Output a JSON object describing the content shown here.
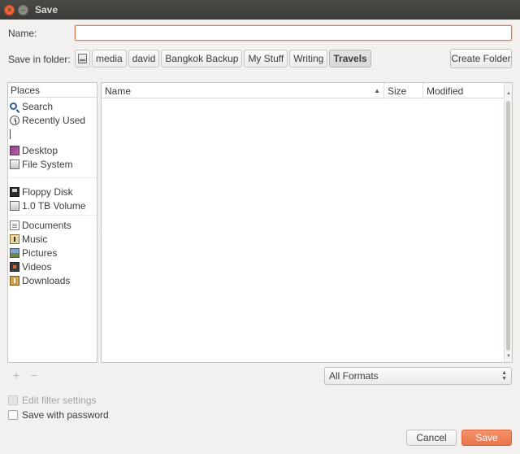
{
  "window": {
    "title": "Save",
    "close_glyph": "×",
    "minimize_glyph": "–"
  },
  "name_field": {
    "label": "Name:",
    "value": ""
  },
  "save_in": {
    "label": "Save in folder:",
    "crumbs": [
      "media",
      "david",
      "Bangkok Backup",
      "My Stuff",
      "Writing",
      "Travels"
    ],
    "active": "Travels"
  },
  "create_folder_label": "Create Folder",
  "places": {
    "header": "Places",
    "items": [
      {
        "label": "Search",
        "icon": "search-icon"
      },
      {
        "label": "Recently Used",
        "icon": "recent-icon"
      },
      {
        "label": "Desktop",
        "icon": "desktop-icon"
      },
      {
        "label": "File System",
        "icon": "drive-icon"
      },
      {
        "label": "Floppy Disk",
        "icon": "floppy-icon"
      },
      {
        "label": "1.0 TB Volume",
        "icon": "drive-icon"
      },
      {
        "label": "Documents",
        "icon": "documents-icon"
      },
      {
        "label": "Music",
        "icon": "music-icon"
      },
      {
        "label": "Pictures",
        "icon": "pictures-icon"
      },
      {
        "label": "Videos",
        "icon": "videos-icon"
      },
      {
        "label": "Downloads",
        "icon": "downloads-icon"
      }
    ]
  },
  "file_list": {
    "columns": {
      "name": "Name",
      "size": "Size",
      "modified": "Modified"
    },
    "sort_glyph": "▲",
    "rows": []
  },
  "add_glyph": "+",
  "remove_glyph": "−",
  "filter": {
    "selected": "All Formats"
  },
  "options": {
    "edit_filter": "Edit filter settings",
    "save_with_password": "Save with password"
  },
  "buttons": {
    "cancel": "Cancel",
    "save": "Save"
  },
  "colors": {
    "accent": "#e9764a",
    "titlebar": "#3c3b37",
    "background": "#f2f1f0"
  }
}
